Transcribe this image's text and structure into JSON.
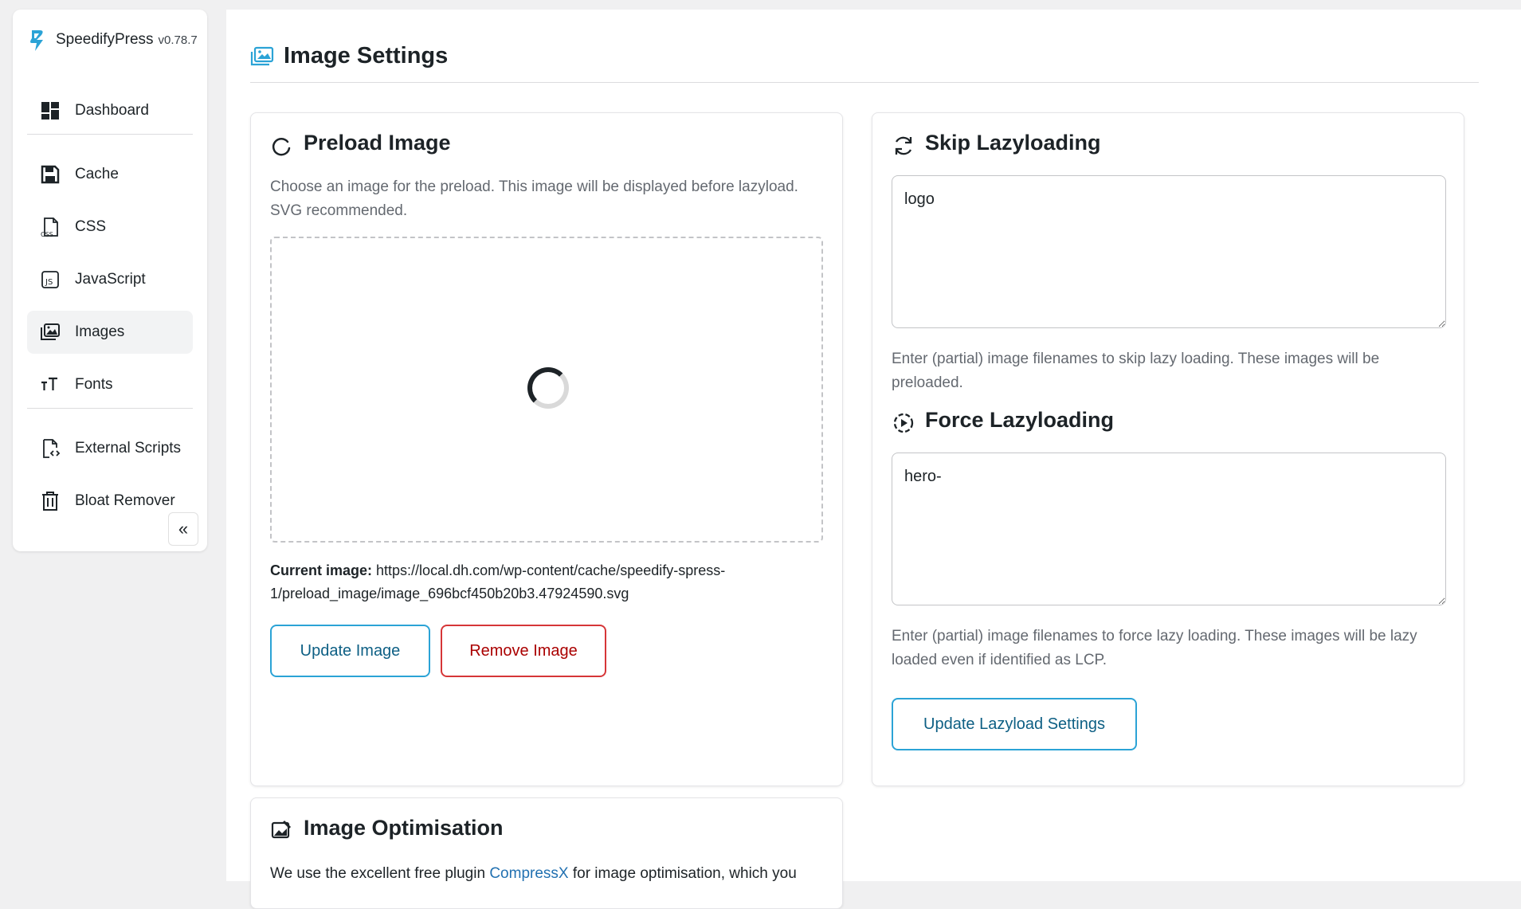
{
  "app": {
    "name": "SpeedifyPress",
    "version": "v0.78.7",
    "brand_color": "#2ba3d6"
  },
  "sidebar": {
    "items": [
      {
        "label": "Dashboard",
        "icon": "dashboard-icon"
      },
      {
        "label": "Cache",
        "icon": "save-icon"
      },
      {
        "label": "CSS",
        "icon": "css-file-icon"
      },
      {
        "label": "JavaScript",
        "icon": "js-file-icon"
      },
      {
        "label": "Images",
        "icon": "images-icon",
        "active": true
      },
      {
        "label": "Fonts",
        "icon": "font-size-icon"
      },
      {
        "label": "External Scripts",
        "icon": "external-script-icon"
      },
      {
        "label": "Bloat Remover",
        "icon": "trash-icon"
      }
    ],
    "collapse_label": "«"
  },
  "page": {
    "title": "Image Settings",
    "icon": "images-icon"
  },
  "preload": {
    "title": "Preload Image",
    "description": "Choose an image for the preload. This image will be displayed before lazyload. SVG recommended.",
    "current_label": "Current image:",
    "current_value": " https://local.dh.com/wp-content/cache/speedify-spress-1/preload_image/image_696bcf450b20b3.47924590.svg",
    "update_button": "Update Image",
    "remove_button": "Remove Image"
  },
  "skip_lazy": {
    "title": "Skip Lazyloading",
    "value": "logo",
    "help": "Enter (partial) image filenames to skip lazy loading. These images will be preloaded."
  },
  "force_lazy": {
    "title": "Force Lazyloading",
    "value": "hero-",
    "help": "Enter (partial) image filenames to force lazy loading. These images will be lazy loaded even if identified as LCP."
  },
  "lazy_button": "Update Lazyload Settings",
  "optimisation": {
    "title": "Image Optimisation",
    "text_before": "We use the excellent free plugin ",
    "link_text": "CompressX",
    "text_after": " for image optimisation, which you"
  }
}
